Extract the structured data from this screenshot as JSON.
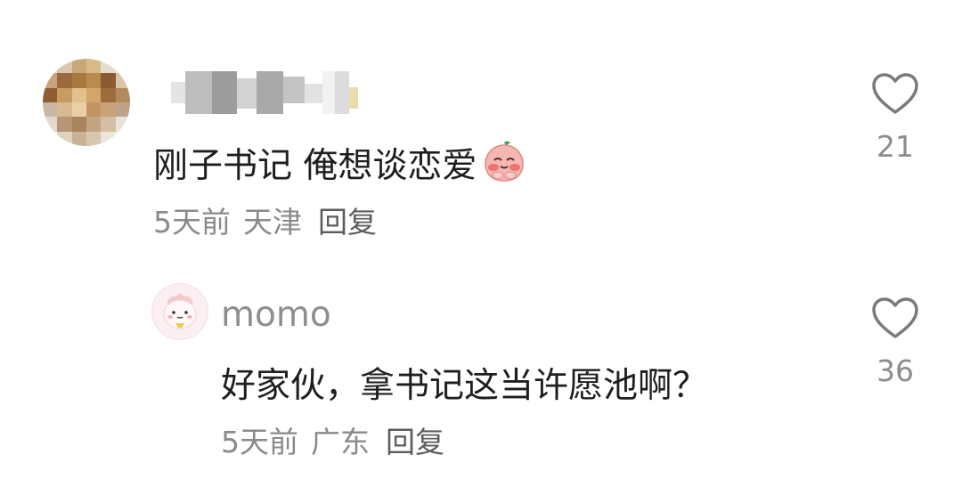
{
  "comments": [
    {
      "username": "",
      "text": "刚子书记 俺想谈恋爱",
      "emoji": "blushing-peach-emoji",
      "time": "5天前",
      "location": "天津",
      "reply_label": "回复",
      "likes": "21"
    },
    {
      "username": "momo",
      "text": "好家伙，拿书记这当许愿池啊？",
      "time": "5天前",
      "location": "广东",
      "reply_label": "回复",
      "likes": "36"
    }
  ],
  "icons": {
    "like": "heart-outline-icon"
  },
  "colors": {
    "text": "#1e1e1e",
    "meta": "#8a8a8a",
    "reply": "#5c5c5c",
    "heart_stroke": "#7a7a7a"
  }
}
